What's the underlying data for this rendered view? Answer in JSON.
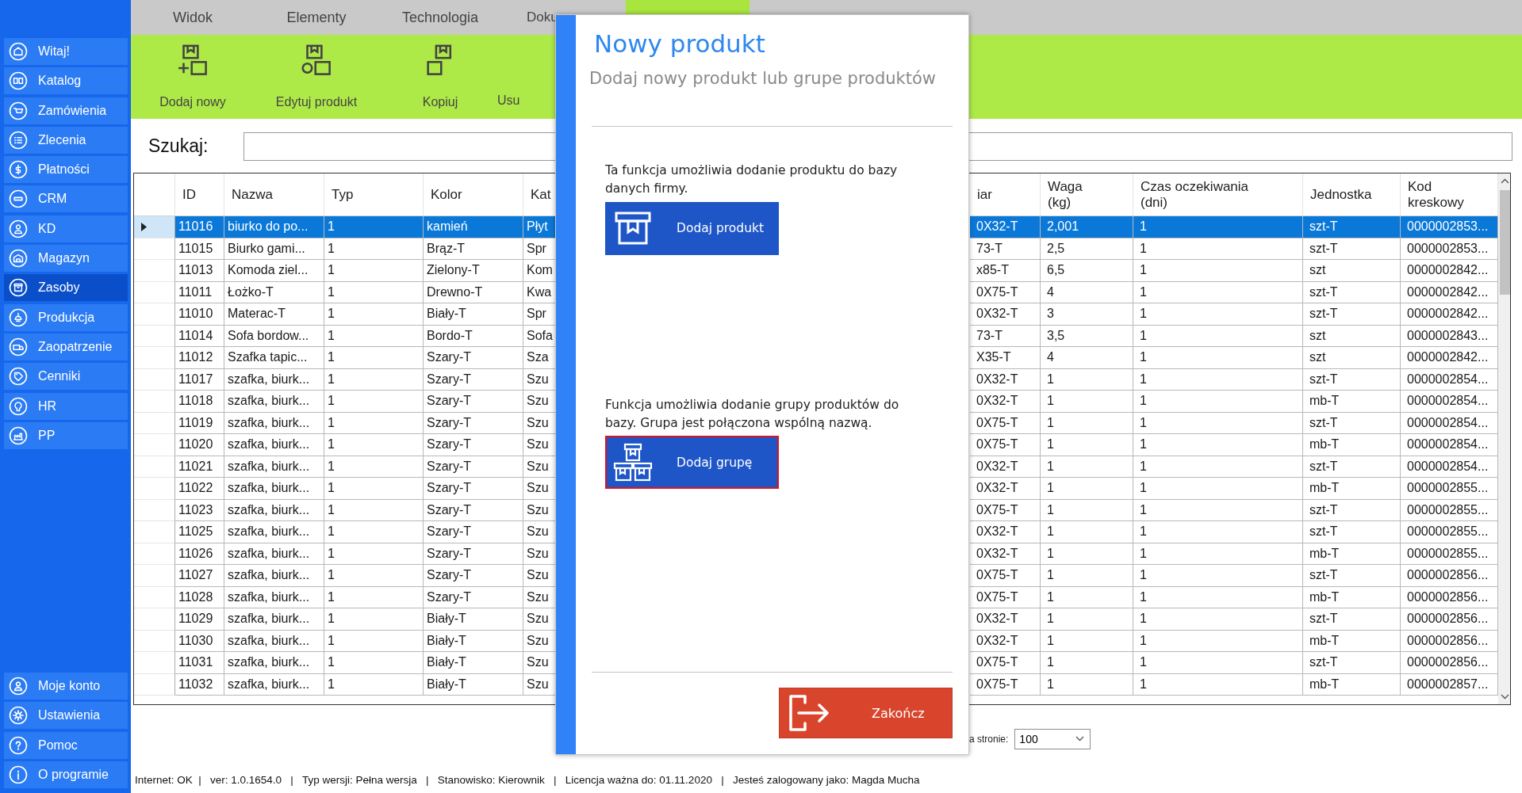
{
  "sidebar": {
    "items": [
      {
        "label": "Witaj!",
        "selected": false
      },
      {
        "label": "Katalog",
        "selected": false
      },
      {
        "label": "Zamówienia",
        "selected": false
      },
      {
        "label": "Zlecenia",
        "selected": false
      },
      {
        "label": "Płatności",
        "selected": false
      },
      {
        "label": "CRM",
        "selected": false
      },
      {
        "label": "KD",
        "selected": false
      },
      {
        "label": "Magazyn",
        "selected": false
      },
      {
        "label": "Zasoby",
        "selected": true
      },
      {
        "label": "Produkcja",
        "selected": false
      },
      {
        "label": "Zaopatrzenie",
        "selected": false
      },
      {
        "label": "Cenniki",
        "selected": false
      },
      {
        "label": "HR",
        "selected": false
      },
      {
        "label": "PP",
        "selected": false
      }
    ],
    "bottom_items": [
      {
        "label": "Moje konto",
        "selected": false
      },
      {
        "label": "Ustawienia",
        "selected": false
      },
      {
        "label": "Pomoc",
        "selected": false
      },
      {
        "label": "O programie",
        "selected": false
      }
    ]
  },
  "tabs": [
    {
      "label": "Widok",
      "selected": false
    },
    {
      "label": "Elementy",
      "selected": false
    },
    {
      "label": "Technologia",
      "selected": false
    },
    {
      "label": "Doku",
      "selected": false
    },
    {
      "selected": true
    }
  ],
  "toolbar": {
    "buttons": [
      "Dodaj nowy",
      "Edytuj produkt",
      "Kopiuj",
      "Usu"
    ]
  },
  "search": {
    "label": "Szukaj:"
  },
  "table": {
    "columns": [
      "ID",
      "Nazwa",
      "Typ",
      "Kolor",
      "Kat",
      "iar",
      "Waga\n(kg)",
      "Czas oczekiwania\n(dni)",
      "Jednostka",
      "Kod\nkreskowy"
    ],
    "rows": [
      {
        "selected": true,
        "cells": [
          "11016",
          "biurko do po...",
          "1",
          "kamień",
          "Płyt",
          "0X32-T",
          "2,001",
          "1",
          "szt-T",
          "0000002853..."
        ]
      },
      {
        "selected": false,
        "cells": [
          "11015",
          "Biurko gami...",
          "1",
          "Brąz-T",
          "Spr",
          "73-T",
          "2,5",
          "1",
          "szt-T",
          "0000002853..."
        ]
      },
      {
        "selected": false,
        "cells": [
          "11013",
          "Komoda ziel...",
          "1",
          "Zielony-T",
          "Kom",
          "x85-T",
          "6,5",
          "1",
          "szt",
          "0000002842..."
        ]
      },
      {
        "selected": false,
        "cells": [
          "11011",
          "Łożko-T",
          "1",
          "Drewno-T",
          "Kwa",
          "0X75-T",
          "4",
          "1",
          "szt-T",
          "0000002842..."
        ]
      },
      {
        "selected": false,
        "cells": [
          "11010",
          "Materac-T",
          "1",
          "Biały-T",
          "Spr",
          "0X32-T",
          "3",
          "1",
          "szt-T",
          "0000002842..."
        ]
      },
      {
        "selected": false,
        "cells": [
          "11014",
          "Sofa bordow...",
          "1",
          "Bordo-T",
          "Sofa",
          "73-T",
          "3,5",
          "1",
          "szt",
          "0000002843..."
        ]
      },
      {
        "selected": false,
        "cells": [
          "11012",
          "Szafka tapic...",
          "1",
          "Szary-T",
          "Sza",
          "X35-T",
          "4",
          "1",
          "szt",
          "0000002842..."
        ]
      },
      {
        "selected": false,
        "cells": [
          "11017",
          "szafka, biurk...",
          "1",
          "Szary-T",
          "Szu",
          "0X32-T",
          "1",
          "1",
          "szt-T",
          "0000002854..."
        ]
      },
      {
        "selected": false,
        "cells": [
          "11018",
          "szafka, biurk...",
          "1",
          "Szary-T",
          "Szu",
          "0X32-T",
          "1",
          "1",
          "mb-T",
          "0000002854..."
        ]
      },
      {
        "selected": false,
        "cells": [
          "11019",
          "szafka, biurk...",
          "1",
          "Szary-T",
          "Szu",
          "0X75-T",
          "1",
          "1",
          "szt-T",
          "0000002854..."
        ]
      },
      {
        "selected": false,
        "cells": [
          "11020",
          "szafka, biurk...",
          "1",
          "Szary-T",
          "Szu",
          "0X75-T",
          "1",
          "1",
          "mb-T",
          "0000002854..."
        ]
      },
      {
        "selected": false,
        "cells": [
          "11021",
          "szafka, biurk...",
          "1",
          "Szary-T",
          "Szu",
          "0X32-T",
          "1",
          "1",
          "szt-T",
          "0000002854..."
        ]
      },
      {
        "selected": false,
        "cells": [
          "11022",
          "szafka, biurk...",
          "1",
          "Szary-T",
          "Szu",
          "0X32-T",
          "1",
          "1",
          "mb-T",
          "0000002855..."
        ]
      },
      {
        "selected": false,
        "cells": [
          "11023",
          "szafka, biurk...",
          "1",
          "Szary-T",
          "Szu",
          "0X75-T",
          "1",
          "1",
          "szt-T",
          "0000002855..."
        ]
      },
      {
        "selected": false,
        "cells": [
          "11025",
          "szafka, biurk...",
          "1",
          "Szary-T",
          "Szu",
          "0X32-T",
          "1",
          "1",
          "szt-T",
          "0000002855..."
        ]
      },
      {
        "selected": false,
        "cells": [
          "11026",
          "szafka, biurk...",
          "1",
          "Szary-T",
          "Szu",
          "0X32-T",
          "1",
          "1",
          "mb-T",
          "0000002855..."
        ]
      },
      {
        "selected": false,
        "cells": [
          "11027",
          "szafka, biurk...",
          "1",
          "Szary-T",
          "Szu",
          "0X75-T",
          "1",
          "1",
          "szt-T",
          "0000002856..."
        ]
      },
      {
        "selected": false,
        "cells": [
          "11028",
          "szafka, biurk...",
          "1",
          "Szary-T",
          "Szu",
          "0X75-T",
          "1",
          "1",
          "mb-T",
          "0000002856..."
        ]
      },
      {
        "selected": false,
        "cells": [
          "11029",
          "szafka, biurk...",
          "1",
          "Biały-T",
          "Szu",
          "0X32-T",
          "1",
          "1",
          "szt-T",
          "0000002856..."
        ]
      },
      {
        "selected": false,
        "cells": [
          "11030",
          "szafka, biurk...",
          "1",
          "Biały-T",
          "Szu",
          "0X32-T",
          "1",
          "1",
          "mb-T",
          "0000002856..."
        ]
      },
      {
        "selected": false,
        "cells": [
          "11031",
          "szafka, biurk...",
          "1",
          "Biały-T",
          "Szu",
          "0X75-T",
          "1",
          "1",
          "szt-T",
          "0000002856..."
        ]
      },
      {
        "selected": false,
        "cells": [
          "11032",
          "szafka, biurk...",
          "1",
          "Biały-T",
          "Szu",
          "0X75-T",
          "1",
          "1",
          "mb-T",
          "0000002857..."
        ]
      }
    ]
  },
  "pagination": {
    "label": "a stronie:",
    "value": "100"
  },
  "status_bar": "Internet: OK  |   ver: 1.0.1654.0   |   Typ wersji: Pełna wersja   |   Stanowisko: Kierownik   |   Licencja ważna do: 01.11.2020   |   Jesteś zalogowany jako: Magda Mucha",
  "dialog": {
    "title": "Nowy produkt",
    "subtitle": "Dodaj nowy produkt lub grupe produktów",
    "options": [
      {
        "kind": "single",
        "description": "Ta funkcja umożliwia dodanie produktu do bazy danych firmy.",
        "button": "Dodaj produkt",
        "focused": false
      },
      {
        "kind": "group",
        "description": "Funkcja umożliwia dodanie grupy produktów do bazy. Grupa jest połączona wspólną nazwą.",
        "button": "Dodaj grupę",
        "focused": true
      }
    ],
    "close_button": "Zakończ"
  }
}
